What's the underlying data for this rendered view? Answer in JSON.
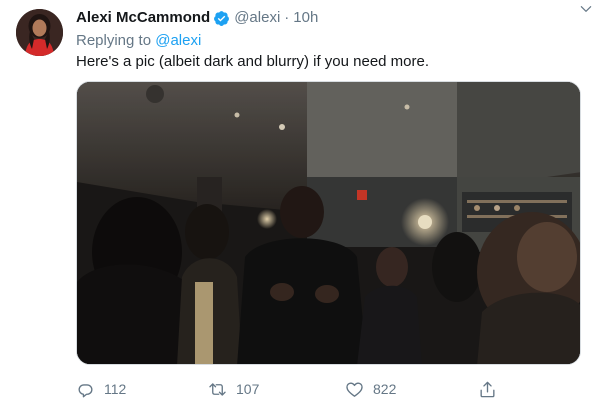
{
  "tweet": {
    "author_name": "Alexi McCammond",
    "handle": "@alexi",
    "separator": "·",
    "time": "10h",
    "replying_prefix": "Replying to",
    "replying_to": "@alexi",
    "text": "Here's a pic (albeit dark and blurry) if you need more."
  },
  "actions": {
    "reply_count": "112",
    "retweet_count": "107",
    "like_count": "822"
  },
  "icons": {
    "verified": "verified-badge-icon",
    "caret": "chevron-down-icon",
    "reply": "reply-icon",
    "retweet": "retweet-icon",
    "like": "heart-icon",
    "share": "share-icon"
  },
  "colors": {
    "accent": "#1da1f2",
    "muted": "#657786",
    "text": "#14171a"
  }
}
